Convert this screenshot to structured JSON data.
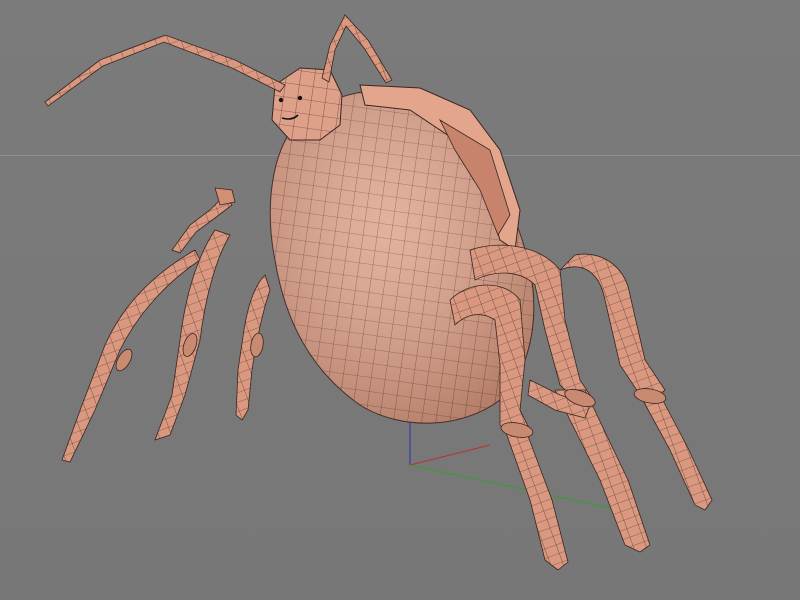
{
  "viewport": {
    "background_color": "#7a7a7a",
    "horizon_line_color": "#8e8e8e"
  },
  "model": {
    "name_icon": "spider-creature-mesh-icon",
    "surface_color": "#dea088",
    "surface_shadow_color": "#b87460",
    "wire_color": "#3a2620"
  },
  "axis_gizmo": {
    "x_color": "#c03030",
    "y_color": "#30a030",
    "z_color": "#3030c0"
  }
}
